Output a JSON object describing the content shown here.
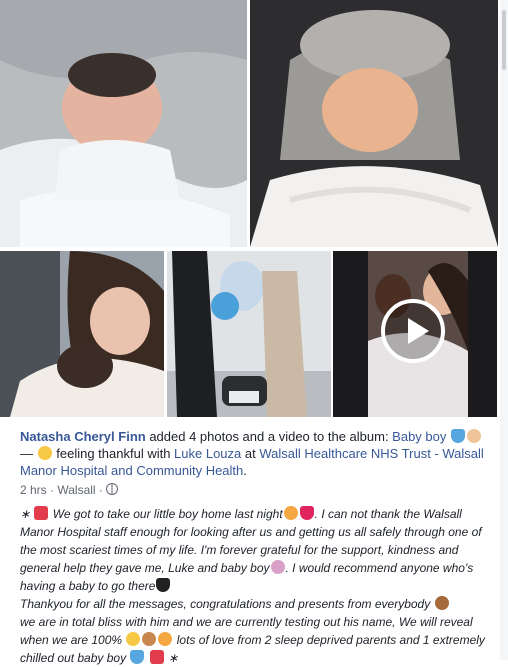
{
  "post": {
    "author": "Natasha Cheryl Finn",
    "action_text": " added 4 photos and a video to the album: ",
    "album_name": "Baby boy",
    "dash": " — ",
    "feeling_text": "feeling thankful with ",
    "tagged_person": "Luke Louza",
    "at_text": " at ",
    "location": "Walsall Healthcare NHS Trust - Walsall Manor Hospital and Community Health",
    "period": ".",
    "time": "2 hrs",
    "separator": " · ",
    "place": "Walsall",
    "separator2": " · ",
    "body_p1_a": "We got to take our little boy home last night",
    "body_p1_b": ". I can not thank the Walsall Manor Hospital staff enough for looking after us and getting us all safely through one of the most scariest times of my life. I'm forever grateful for the support, kindness and general help they gave me, Luke and baby boy",
    "body_p1_c": ". I would recommend anyone who's having a baby to go there",
    "body_p2": "Thankyou for all the messages, congratulations and presents from everybody",
    "body_p3_a": "we are in total bliss with him and we are currently testing out his name, We will reveal when we are 100%",
    "body_p3_b": " lots of love from 2 sleep deprived parents and 1 extremely chilled out baby boy",
    "star": "∗",
    "star_end": " ∗"
  },
  "media": {
    "photo_count": 4,
    "video_count": 1
  },
  "icons": [
    "bow-icon",
    "heart-blue-icon",
    "heart-red-icon",
    "heart-black-icon",
    "smile-icon",
    "baby-icon",
    "bear-icon",
    "globe-icon",
    "play-icon"
  ],
  "colors": {
    "link": "#385898",
    "meta": "#616770",
    "text": "#1d2129"
  }
}
